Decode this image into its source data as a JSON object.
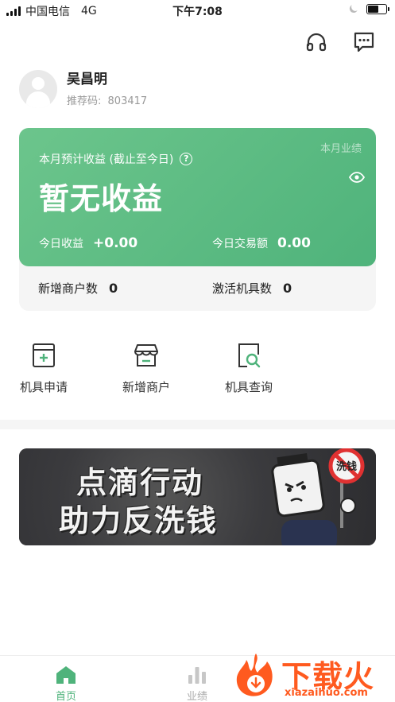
{
  "status_bar": {
    "carrier": "中国电信",
    "network": "4G",
    "time": "下午7:08",
    "battery_level": 0.6
  },
  "header": {
    "headset_icon": "headset-icon",
    "message_icon": "message-dots-icon"
  },
  "profile": {
    "name": "吴昌明",
    "referral_label": "推荐码:",
    "referral_code": "803417"
  },
  "earnings_card": {
    "monthly_link": "本月业绩",
    "label": "本月预计收益 (截止至今日)",
    "help_icon": "?",
    "value": "暂无收益",
    "today_label": "今日收益",
    "today_value": "+0.00",
    "volume_label": "今日交易额",
    "volume_value": "0.00",
    "new_merchants_label": "新增商户数",
    "new_merchants_value": "0",
    "activated_label": "激活机具数",
    "activated_value": "0",
    "accent_color": "#4fb37b"
  },
  "quick_actions": [
    {
      "label": "机具申请",
      "icon": "device-apply-icon"
    },
    {
      "label": "新增商户",
      "icon": "store-icon"
    },
    {
      "label": "机具查询",
      "icon": "device-search-icon"
    }
  ],
  "banner": {
    "line1": "点滴行动",
    "line2": "助力反洗钱",
    "sign_text": "洗钱"
  },
  "tabbar": {
    "tabs": [
      {
        "label": "首页",
        "icon": "home-icon",
        "active": true
      },
      {
        "label": "业绩",
        "icon": "bar-chart-icon",
        "active": false
      }
    ]
  },
  "watermark": {
    "text": "下载火",
    "url": "xiazaihuo.com"
  }
}
